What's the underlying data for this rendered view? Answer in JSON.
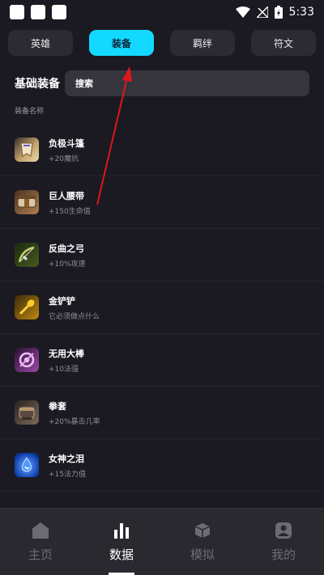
{
  "status_bar": {
    "time": "5:33"
  },
  "tabs": [
    {
      "label": "英雄",
      "active": false
    },
    {
      "label": "装备",
      "active": true
    },
    {
      "label": "羁绊",
      "active": false
    },
    {
      "label": "符文",
      "active": false
    }
  ],
  "section": {
    "title": "基础装备",
    "search_placeholder": "搜索",
    "column_header": "装备名称"
  },
  "items": [
    {
      "name": "负极斗篷",
      "desc": "+20魔抗",
      "icon": "cloak-icon",
      "color": "#b89a6a"
    },
    {
      "name": "巨人腰带",
      "desc": "+150生命值",
      "icon": "belt-icon",
      "color": "#8a6a4a"
    },
    {
      "name": "反曲之弓",
      "desc": "+10%攻速",
      "icon": "bow-icon",
      "color": "#6b7a3a"
    },
    {
      "name": "金铲铲",
      "desc": "它必须做点什么",
      "icon": "spatula-icon",
      "color": "#c89a1a"
    },
    {
      "name": "无用大棒",
      "desc": "+10法强",
      "icon": "rod-icon",
      "color": "#9a5aa8"
    },
    {
      "name": "拳套",
      "desc": "+20%暴击几率",
      "icon": "glove-icon",
      "color": "#6a5a52"
    },
    {
      "name": "女神之泪",
      "desc": "+15法力值",
      "icon": "tear-icon",
      "color": "#2a6ad8"
    }
  ],
  "bottom_nav": [
    {
      "label": "主页",
      "icon": "home-icon",
      "active": false
    },
    {
      "label": "数据",
      "icon": "bar-chart-icon",
      "active": true
    },
    {
      "label": "模拟",
      "icon": "cube-icon",
      "active": false
    },
    {
      "label": "我的",
      "icon": "profile-icon",
      "active": false
    }
  ],
  "colors": {
    "accent": "#12d9ff",
    "annotation_arrow": "#e0161b",
    "background": "#1b1a22"
  }
}
